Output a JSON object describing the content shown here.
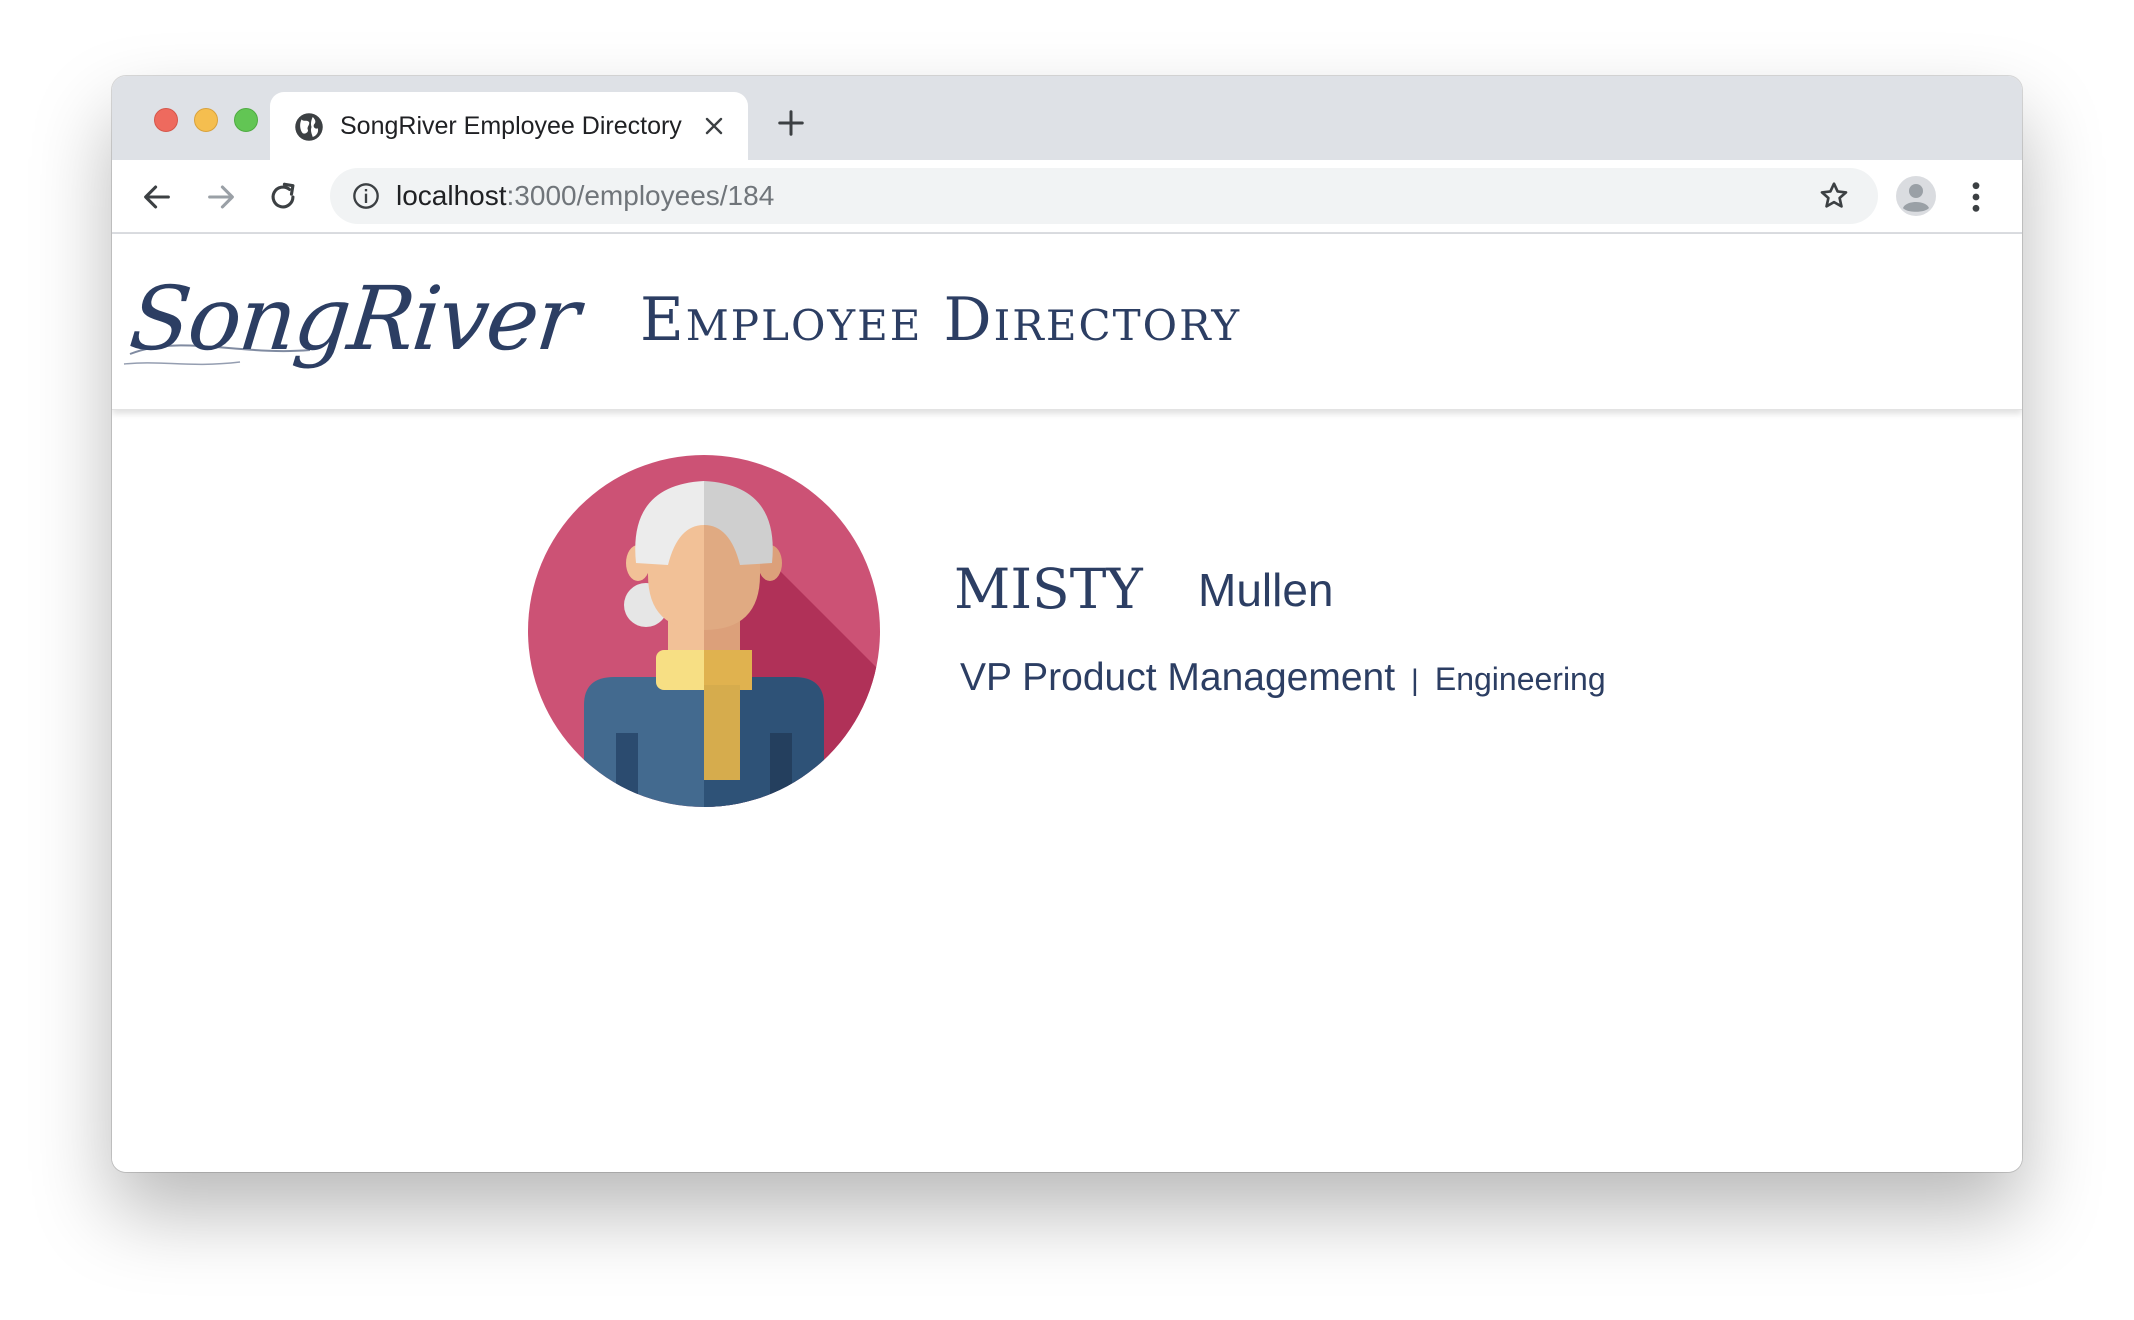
{
  "browser": {
    "tab_title": "SongRiver Employee Directory",
    "url_host": "localhost",
    "url_path": ":3000/employees/184"
  },
  "header": {
    "logo_text": "SongRiver",
    "title": "Employee Directory"
  },
  "employee": {
    "first_name": "Misty",
    "last_name": "Mullen",
    "job_title": "VP Product Management",
    "separator": "|",
    "department": "Engineering"
  },
  "colors": {
    "brand_navy": "#2c3e63",
    "avatar_bg": "#cc5275",
    "avatar_shadow": "#b03158"
  }
}
